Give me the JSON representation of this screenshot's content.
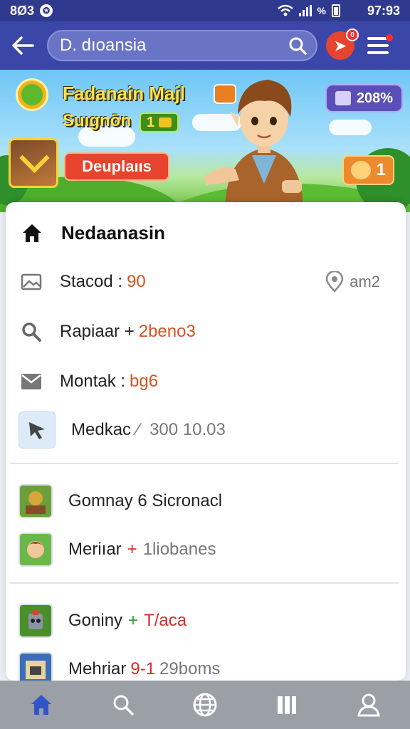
{
  "status_bar": {
    "time_left": "8Ø3",
    "time_right": "97:93",
    "status_icon_char": "✪",
    "percent_char": "%"
  },
  "app_bar": {
    "search_text": "D. dıoansia",
    "notif_char": "➤",
    "notif_count": "0"
  },
  "banner": {
    "title": "Fadanain Majl",
    "subtitle": "Suıgnōn",
    "level": "1",
    "play_button": "Deuplaııs",
    "stat_value": "208%",
    "pet_value": "1"
  },
  "list": {
    "title": "Nedaanasin",
    "rows": [
      {
        "label": "Stacod :",
        "value": "90",
        "trail_text": "am2"
      },
      {
        "label": "Rapiaar +",
        "value": "2beno3"
      },
      {
        "label": "Montak :",
        "value": "bg6"
      },
      {
        "label": "Medkac",
        "value": "300 10.03",
        "prefix": "⁄"
      }
    ],
    "games": [
      {
        "label": "Gomnay 6 Sicronacl",
        "value": ""
      },
      {
        "label": "Meriıar",
        "sign": "+",
        "value": "1liobanes"
      },
      {
        "label": "Goniny",
        "sign": "+",
        "value": "T/aca"
      },
      {
        "label": "Mehriar",
        "value": "9-1",
        "extra": "29boms"
      }
    ]
  },
  "colors": {
    "app_bar": "#3a47a8",
    "accent_red": "#e6442e",
    "accent_orange": "#d8531f"
  }
}
